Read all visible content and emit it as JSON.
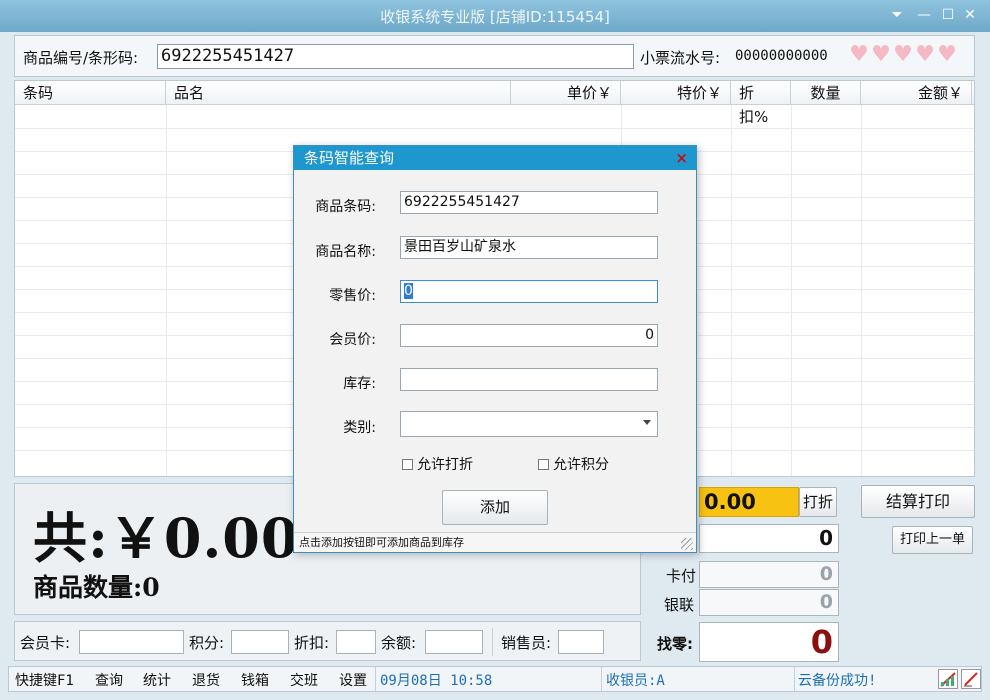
{
  "window": {
    "title": "收银系统专业版 [店铺ID:115454]",
    "controls": [
      "⏷",
      "—",
      "☐",
      "✕"
    ]
  },
  "codebar": {
    "label": "商品编号/条形码:",
    "value": "6922255451427",
    "receipt_label": "小票流水号:",
    "receipt_value": "00000000000",
    "hearts": [
      "♥",
      "♥",
      "♥",
      "♥",
      "♥"
    ]
  },
  "grid": {
    "columns": [
      "条码",
      "品名",
      "单价￥",
      "特价￥",
      "折扣%",
      "数量",
      "金额￥"
    ]
  },
  "totals": {
    "total": "共:￥0.00",
    "quantity": "商品数量:0"
  },
  "payment": {
    "discount_value": "0.00",
    "discount_button": "打折",
    "checkout_button": "结算打印",
    "reprint_button": "打印上一单",
    "cash_value": "0",
    "card_label": "卡付",
    "card_value": "0",
    "unionpay_label": "银联",
    "unionpay_value": "0",
    "change_label": "找零:",
    "change_value": "0"
  },
  "member": {
    "card_label": "会员卡:",
    "points_label": "积分:",
    "discount_label": "折扣:",
    "balance_label": "余额:",
    "seller_label": "销售员:"
  },
  "statusbar": {
    "menu": [
      "快捷键F1",
      "查询",
      "统计",
      "退货",
      "钱箱",
      "交班",
      "设置"
    ],
    "datetime": "09月08日 10:58",
    "cashier": "收银员:A",
    "backup": "云备份成功!"
  },
  "dialog": {
    "title": "条码智能查询",
    "close": "×",
    "barcode_label": "商品条码:",
    "barcode_value": "6922255451427",
    "name_label": "商品名称:",
    "name_value": "景田百岁山矿泉水",
    "retail_label": "零售价:",
    "retail_value": "0",
    "member_price_label": "会员价:",
    "member_price_value": "0",
    "stock_label": "库存:",
    "stock_value": "",
    "category_label": "类别:",
    "category_value": "",
    "allow_discount": "允许打折",
    "allow_points": "允许积分",
    "add_button": "添加",
    "hint": "点击添加按钮即可添加商品到库存"
  }
}
